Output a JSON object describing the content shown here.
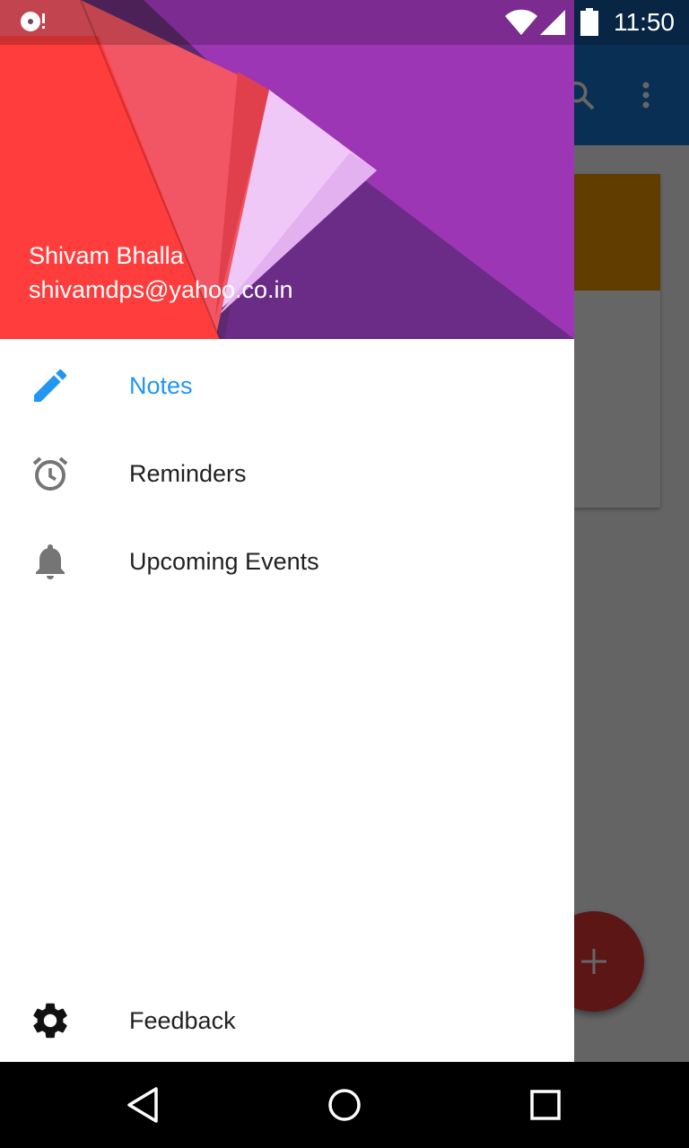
{
  "status_bar": {
    "time": "11:50",
    "icons": [
      "notification-app-icon",
      "wifi-icon",
      "signal-icon",
      "battery-icon"
    ]
  },
  "app_background": {
    "toolbar_color": "#1976D2",
    "card_accent_color": "#F29C00",
    "fab_color": "#E53935",
    "icons": [
      "search-icon",
      "overflow-menu-icon",
      "add-icon"
    ]
  },
  "drawer": {
    "header": {
      "user_name": "Shivam Bhalla",
      "user_email": "shivamdps@yahoo.co.in"
    },
    "items": [
      {
        "label": "Notes",
        "icon": "pencil-icon",
        "active": true
      },
      {
        "label": "Reminders",
        "icon": "alarm-clock-icon",
        "active": false
      },
      {
        "label": "Upcoming Events",
        "icon": "bell-icon",
        "active": false
      }
    ],
    "footer_item": {
      "label": "Feedback",
      "icon": "gear-icon"
    }
  },
  "colors": {
    "accent": "#2196F3",
    "text_primary": "#212121",
    "icon_grey": "#757575"
  },
  "nav_bar": {
    "buttons": [
      "back-icon",
      "home-icon",
      "recents-icon"
    ]
  }
}
